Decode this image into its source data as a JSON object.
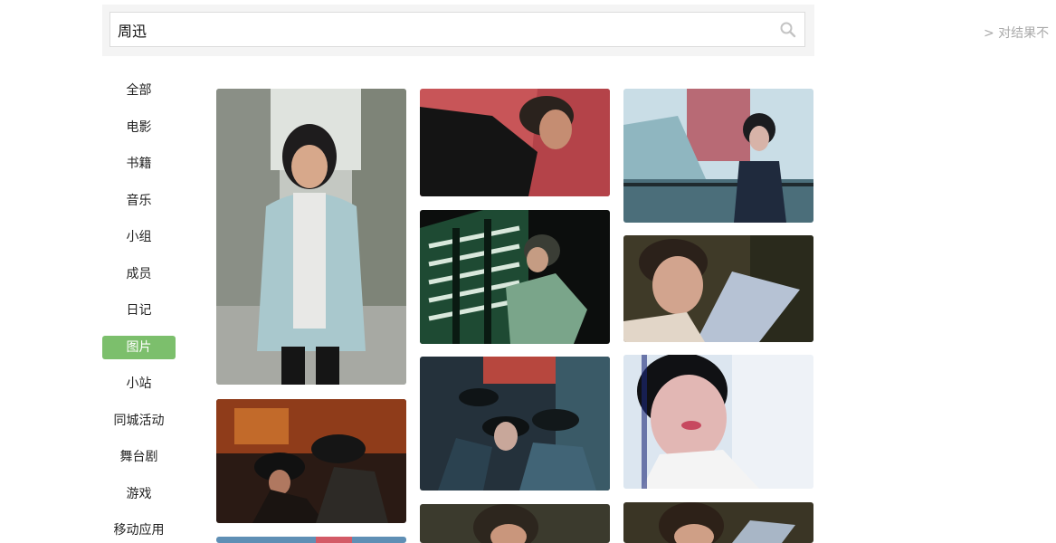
{
  "search": {
    "query": "周迅"
  },
  "feedback": {
    "label": "> 对结果不"
  },
  "sidebar": {
    "items": [
      {
        "label": "全部"
      },
      {
        "label": "电影"
      },
      {
        "label": "书籍"
      },
      {
        "label": "音乐"
      },
      {
        "label": "小组"
      },
      {
        "label": "成员"
      },
      {
        "label": "日记"
      },
      {
        "label": "图片",
        "active": true
      },
      {
        "label": "小站"
      },
      {
        "label": "同城活动"
      },
      {
        "label": "舞台剧"
      },
      {
        "label": "游戏"
      },
      {
        "label": "移动应用"
      }
    ]
  },
  "colors": {
    "accent": "#7cbf6c",
    "muted_text": "#aaaaaa"
  },
  "icons": {
    "search": "search-icon"
  }
}
